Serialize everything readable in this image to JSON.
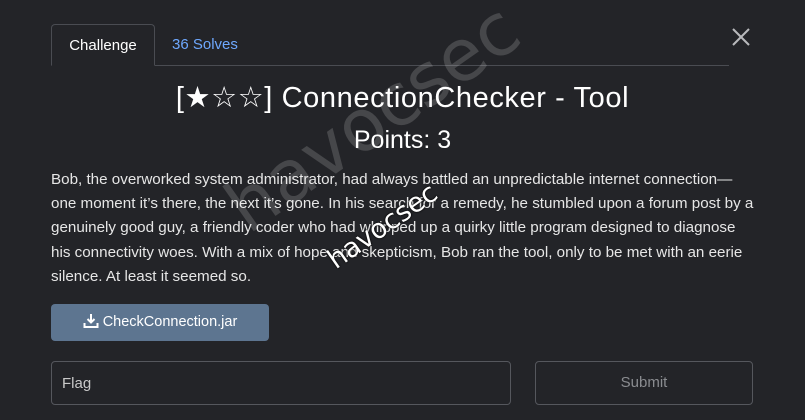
{
  "tabs": {
    "challenge": "Challenge",
    "solves": "36 Solves"
  },
  "challenge": {
    "title": "[★☆☆] ConnectionChecker - Tool",
    "points": "Points: 3",
    "description": "Bob, the overworked system administrator, had always battled an unpredictable internet connection—one moment it’s there, the next it’s gone. In his search for a remedy, he stumbled upon a forum post by a genuinely good guy, a friendly coder who had whipped up a quirky little program designed to diagnose his connectivity woes. With a mix of hope and skepticism, Bob ran the tool, only to be met with an eerie silence. At least it seemed so.",
    "file_label": "CheckConnection.jar"
  },
  "form": {
    "flag_placeholder": "Flag",
    "flag_value": "",
    "submit_label": "Submit"
  },
  "watermark": {
    "big": "havocsec",
    "small": "havocsec"
  },
  "icons": {
    "close": "close-icon",
    "download": "download-icon"
  },
  "colors": {
    "link": "#6ea8fe",
    "download_button": "#5d7590",
    "modal_bg": "#232428"
  }
}
